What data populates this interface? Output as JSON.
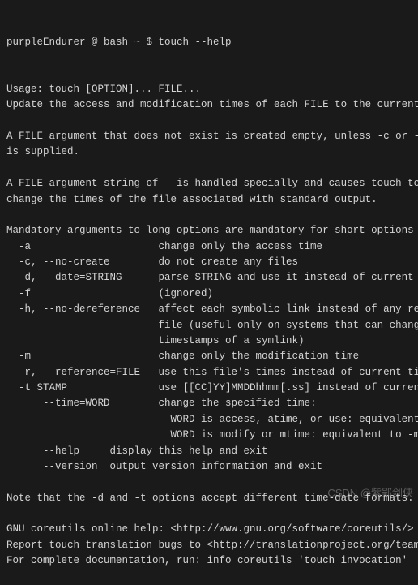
{
  "prompt": {
    "user": "purpleEndurer @ bash ~ $ ",
    "command": "touch --help"
  },
  "lines": [
    "Usage: touch [OPTION]... FILE...",
    "Update the access and modification times of each FILE to the current time.",
    "",
    "A FILE argument that does not exist is created empty, unless -c or -h",
    "is supplied.",
    "",
    "A FILE argument string of - is handled specially and causes touch to",
    "change the times of the file associated with standard output.",
    "",
    "Mandatory arguments to long options are mandatory for short options too.",
    "  -a                     change only the access time",
    "  -c, --no-create        do not create any files",
    "  -d, --date=STRING      parse STRING and use it instead of current time",
    "  -f                     (ignored)",
    "  -h, --no-dereference   affect each symbolic link instead of any referenced",
    "                         file (useful only on systems that can change the",
    "                         timestamps of a symlink)",
    "  -m                     change only the modification time",
    "  -r, --reference=FILE   use this file's times instead of current time",
    "  -t STAMP               use [[CC]YY]MMDDhhmm[.ss] instead of current time",
    "      --time=WORD        change the specified time:",
    "                           WORD is access, atime, or use: equivalent to -a",
    "                           WORD is modify or mtime: equivalent to -m",
    "      --help     display this help and exit",
    "      --version  output version information and exit",
    "",
    "Note that the -d and -t options accept different time-date formats.",
    "",
    "GNU coreutils online help: <http://www.gnu.org/software/coreutils/>",
    "Report touch translation bugs to <http://translationproject.org/team/>",
    "For complete documentation, run: info coreutils 'touch invocation'"
  ],
  "watermark": "CSDN @紫郢剑侠"
}
